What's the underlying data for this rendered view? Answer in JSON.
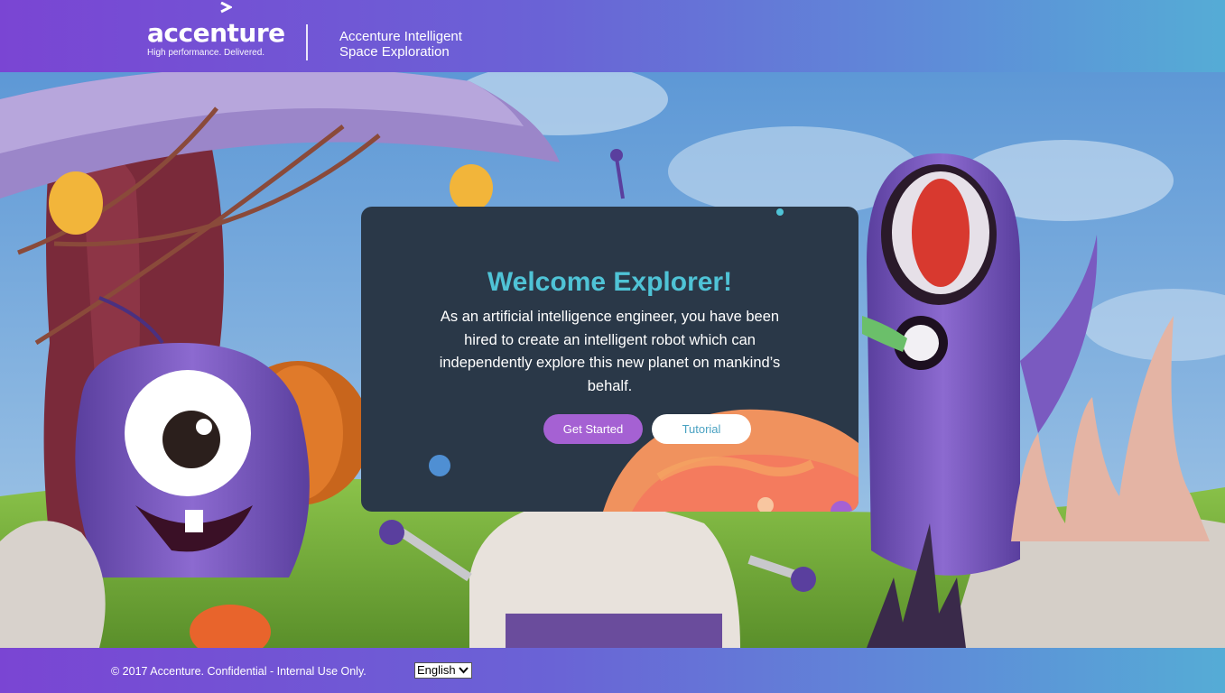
{
  "header": {
    "logo_text": "accenture",
    "logo_tagline": "High performance. Delivered.",
    "app_title_line1": "Accenture Intelligent",
    "app_title_line2": "Space Exploration"
  },
  "modal": {
    "title": "Welcome Explorer!",
    "body": "As an artificial intelligence engineer, you have been hired to create an intelligent robot which can independently explore this new planet on mankind’s behalf.",
    "get_started_label": "Get Started",
    "tutorial_label": "Tutorial"
  },
  "footer": {
    "copyright": "© 2017 Accenture. Confidential - Internal Use Only.",
    "language_selected": "English"
  },
  "icons": {
    "logo_mark": "accenture-chevron-icon",
    "select_arrow": "chevron-down-icon"
  },
  "colors": {
    "header_gradient_start": "#7a45d3",
    "header_gradient_end": "#55acd6",
    "modal_bg": "#2a3848",
    "title_color": "#4fc3d6",
    "primary_button": "#a561d3",
    "tutorial_text": "#4aa2c2"
  }
}
